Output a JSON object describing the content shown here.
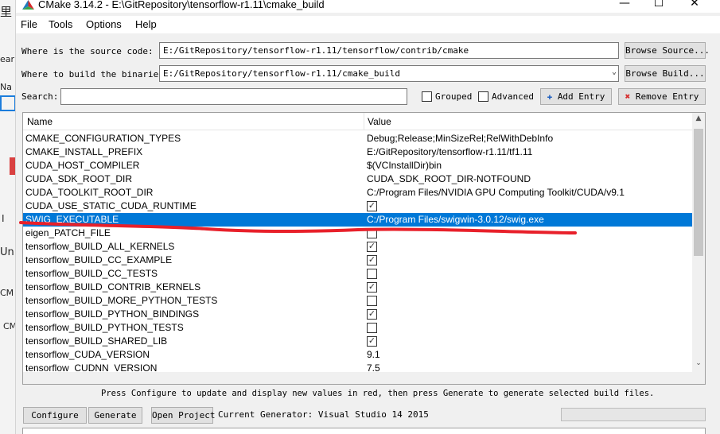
{
  "background_app": {
    "fragments": [
      "里",
      "ear",
      "Na",
      "I",
      "Un",
      "CM",
      "CM"
    ]
  },
  "window": {
    "title": "CMake 3.14.2 - E:\\GitRepository\\tensorflow-r1.11\\cmake_build",
    "minimize": "—",
    "maximize": "☐",
    "close": "✕"
  },
  "menu": {
    "items": [
      "File",
      "Tools",
      "Options",
      "Help"
    ]
  },
  "source": {
    "label": "Where is the source code:",
    "value": "E:/GitRepository/tensorflow-r1.11/tensorflow/contrib/cmake",
    "browse": "Browse Source..."
  },
  "build": {
    "label": "Where to build the binaries:",
    "value": "E:/GitRepository/tensorflow-r1.11/cmake_build",
    "browse": "Browse Build..."
  },
  "search": {
    "label": "Search:",
    "value": "",
    "grouped": "Grouped",
    "advanced": "Advanced",
    "add_entry": "Add Entry",
    "remove_entry": "Remove Entry"
  },
  "table": {
    "headers": [
      "Name",
      "Value"
    ],
    "rows": [
      {
        "name": "CMAKE_CONFIGURATION_TYPES",
        "value": "Debug;Release;MinSizeRel;RelWithDebInfo"
      },
      {
        "name": "CMAKE_INSTALL_PREFIX",
        "value": "E:/GitRepository/tensorflow-r1.11/tf1.11"
      },
      {
        "name": "CUDA_HOST_COMPILER",
        "value": "$(VCInstallDir)bin"
      },
      {
        "name": "CUDA_SDK_ROOT_DIR",
        "value": "CUDA_SDK_ROOT_DIR-NOTFOUND"
      },
      {
        "name": "CUDA_TOOLKIT_ROOT_DIR",
        "value": "C:/Program Files/NVIDIA GPU Computing Toolkit/CUDA/v9.1"
      },
      {
        "name": "CUDA_USE_STATIC_CUDA_RUNTIME",
        "value": "✓"
      },
      {
        "name": "SWIG_EXECUTABLE",
        "value": "C:/Program Files/swigwin-3.0.12/swig.exe"
      },
      {
        "name": "eigen_PATCH_FILE",
        "value": ""
      },
      {
        "name": "tensorflow_BUILD_ALL_KERNELS",
        "value": "✓"
      },
      {
        "name": "tensorflow_BUILD_CC_EXAMPLE",
        "value": "✓"
      },
      {
        "name": "tensorflow_BUILD_CC_TESTS",
        "value": ""
      },
      {
        "name": "tensorflow_BUILD_CONTRIB_KERNELS",
        "value": "✓"
      },
      {
        "name": "tensorflow_BUILD_MORE_PYTHON_TESTS",
        "value": ""
      },
      {
        "name": "tensorflow_BUILD_PYTHON_BINDINGS",
        "value": "✓"
      },
      {
        "name": "tensorflow_BUILD_PYTHON_TESTS",
        "value": ""
      },
      {
        "name": "tensorflow_BUILD_SHARED_LIB",
        "value": "✓"
      },
      {
        "name": "tensorflow_CUDA_VERSION",
        "value": "9.1"
      },
      {
        "name": "tensorflow_CUDNN_VERSION",
        "value": "7.5"
      }
    ],
    "checkbox_rows": [
      5,
      7,
      8,
      9,
      10,
      11,
      12,
      13,
      14,
      15
    ],
    "selected_row": 6
  },
  "hint": "Press Configure to update and display new values in red, then press Generate to generate selected build files.",
  "bottom": {
    "configure": "Configure",
    "generate": "Generate",
    "open_project": "Open Project",
    "generator": "Current Generator: Visual Studio 14 2015"
  },
  "colors": {
    "selection": "#0078d7",
    "annotation": "#e8202a"
  }
}
